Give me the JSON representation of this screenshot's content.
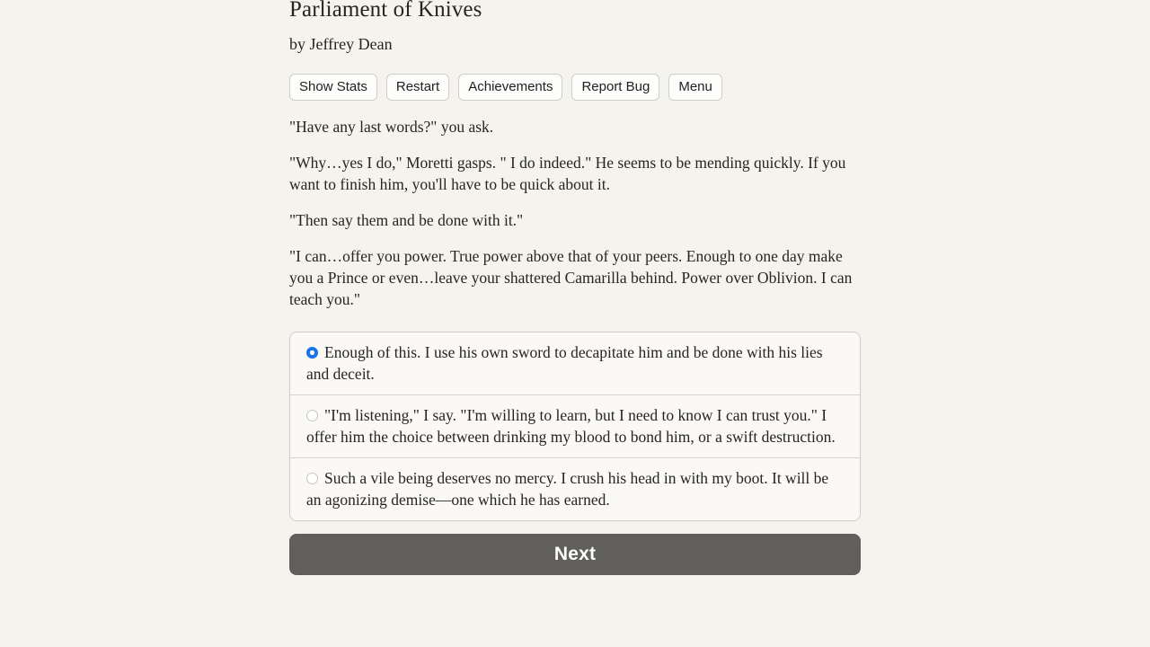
{
  "game": {
    "title": "Parliament of Knives",
    "byline": "by Jeffrey Dean"
  },
  "toolbar": {
    "buttons": [
      {
        "label": "Show Stats",
        "name": "show-stats-button"
      },
      {
        "label": "Restart",
        "name": "restart-button"
      },
      {
        "label": "Achievements",
        "name": "achievements-button"
      },
      {
        "label": "Report Bug",
        "name": "report-bug-button"
      },
      {
        "label": "Menu",
        "name": "menu-button"
      }
    ]
  },
  "story": {
    "paragraphs": [
      "\"Have any last words?\" you ask.",
      "\"Why…yes I do,\" Moretti gasps. \" I do indeed.\" He seems to be mending quickly. If you want to finish him, you'll have to be quick about it.",
      "\"Then say them and be done with it.\"",
      "\"I can…offer you power. True power above that of your peers. Enough to one day make you a Prince or even…leave your shattered Camarilla behind. Power over Oblivion. I can teach you.\""
    ]
  },
  "choices": {
    "options": [
      {
        "text": "Enough of this. I use his own sword to decapitate him and be done with his lies and deceit.",
        "selected": true
      },
      {
        "text": "\"I'm listening,\" I say. \"I'm willing to learn, but I need to know I can trust you.\" I offer him the choice between drinking my blood to bond him, or a swift destruction.",
        "selected": false
      },
      {
        "text": "Such a vile being deserves no mercy. I crush his head in with my boot. It will be an agonizing demise—one which he has earned.",
        "selected": false
      }
    ]
  },
  "actions": {
    "next_label": "Next"
  },
  "colors": {
    "page_background": "#f5f3ee",
    "text": "#26251f",
    "accent_radio": "#1b73e8",
    "next_button_background": "#615f5c",
    "border": "#cfcdc8"
  }
}
